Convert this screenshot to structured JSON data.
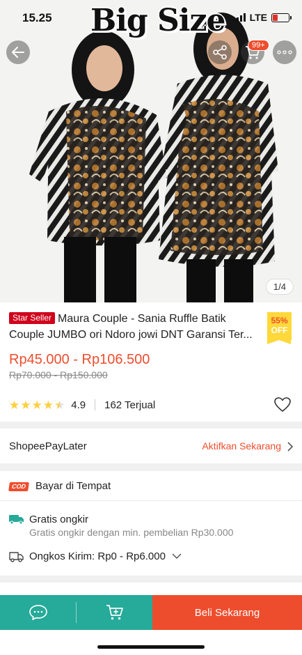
{
  "status": {
    "time": "15.25",
    "network": "LTE"
  },
  "hero": {
    "overlay_text": "Big Size",
    "image_counter": "1/4",
    "cart_badge": "99+"
  },
  "product": {
    "badge": "Star Seller",
    "title": "Maura Couple - Sania Ruffle Batik Couple JUMBO ori Ndoro jowi DNT Garansi Ter...",
    "discount_pct": "55%",
    "discount_off": "OFF",
    "price": "Rp45.000 - Rp106.500",
    "original_price": "Rp70.000 - Rp150.000",
    "rating": "4.9",
    "rating_stars": 4.5,
    "sold": "162 Terjual"
  },
  "paylater": {
    "label": "ShopeePayLater",
    "action": "Aktifkan Sekarang"
  },
  "cod": {
    "badge": "COD",
    "label": "Bayar di Tempat"
  },
  "shipping": {
    "free_icon_text": "Free",
    "title": "Gratis ongkir",
    "subtitle": "Gratis ongkir dengan min. pembelian Rp30.000",
    "cost_label": "Ongkos Kirim:",
    "cost_value": "Rp0 - Rp6.000"
  },
  "bottom_bar": {
    "buy_label": "Beli Sekarang"
  },
  "colors": {
    "accent": "#ee4d2d",
    "teal": "#26aa99",
    "star": "#ffce3d"
  }
}
